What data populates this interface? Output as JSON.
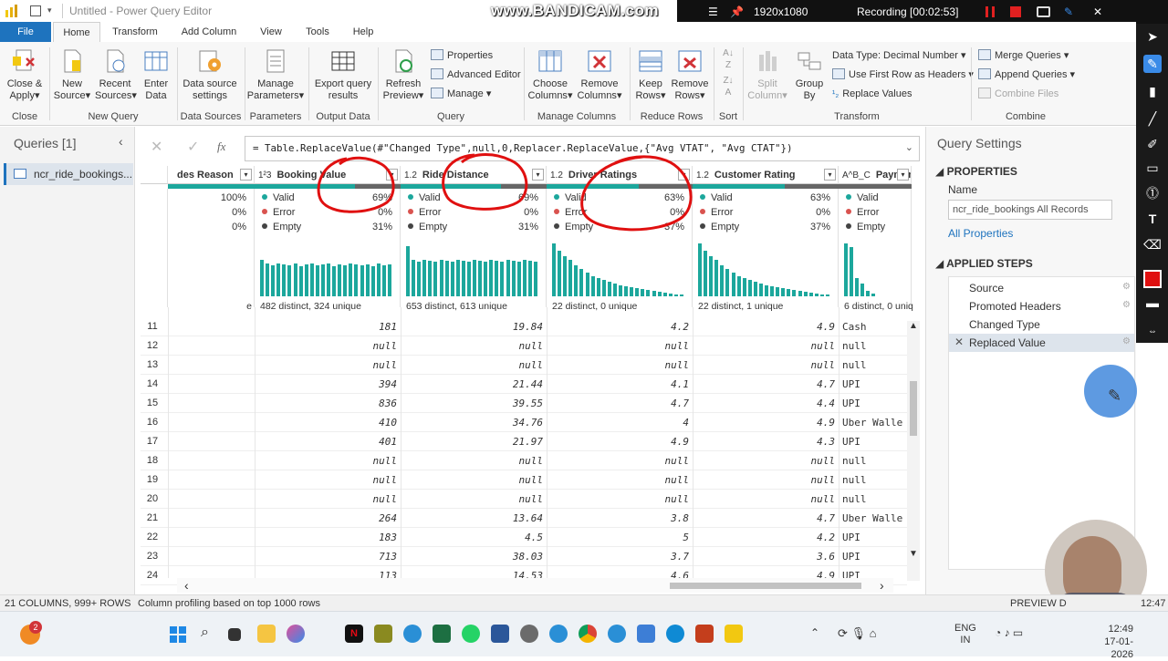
{
  "window": {
    "title": "Untitled - Power Query Editor",
    "watermark": "www.BANDICAM.com",
    "recorder": {
      "resolution": "1920x1080",
      "status": "Recording [00:02:53]"
    }
  },
  "tabs": [
    "File",
    "Home",
    "Transform",
    "Add Column",
    "View",
    "Tools",
    "Help"
  ],
  "ribbon": {
    "close_apply": "Close &\nApply",
    "new_source": "New\nSource",
    "recent_sources": "Recent\nSources",
    "enter_data": "Enter\nData",
    "data_source_settings": "Data source\nsettings",
    "manage_parameters": "Manage\nParameters",
    "export_query_results": "Export query\nresults",
    "refresh_preview": "Refresh\nPreview",
    "properties": "Properties",
    "advanced_editor": "Advanced Editor",
    "manage": "Manage",
    "choose_columns": "Choose\nColumns",
    "remove_columns": "Remove\nColumns",
    "keep_rows": "Keep\nRows",
    "remove_rows": "Remove\nRows",
    "split_column": "Split\nColumn",
    "group_by": "Group\nBy",
    "data_type": "Data Type: Decimal Number",
    "use_first_row": "Use First Row as Headers",
    "replace_values": "Replace Values",
    "merge_queries": "Merge Queries",
    "append_queries": "Append Queries",
    "combine_files": "Combine Files",
    "groups": [
      "Close",
      "New Query",
      "Data Sources",
      "Parameters",
      "Output Data",
      "Query",
      "Manage Columns",
      "Reduce Rows",
      "Sort",
      "Transform",
      "Combine"
    ]
  },
  "queries_pane": {
    "title": "Queries [1]",
    "item": "ncr_ride_bookings..."
  },
  "formula": "= Table.ReplaceValue(#\"Changed Type\",null,0,Replacer.ReplaceValue,{\"Avg VTAT\", \"Avg CTAT\"})",
  "formula_fx": "fx",
  "columns": [
    {
      "type": "",
      "name": "des Reason",
      "valid": "100%",
      "error": "0%",
      "empty": "0%",
      "distinct": ""
    },
    {
      "type": "1²3",
      "name": "Booking Value",
      "valid": "69%",
      "error": "0%",
      "empty": "31%",
      "distinct": "482 distinct, 324 unique"
    },
    {
      "type": "1.2",
      "name": "Ride Distance",
      "valid": "69%",
      "error": "0%",
      "empty": "31%",
      "distinct": "653 distinct, 613 unique"
    },
    {
      "type": "1.2",
      "name": "Driver Ratings",
      "valid": "63%",
      "error": "0%",
      "empty": "37%",
      "distinct": "22 distinct, 0 unique"
    },
    {
      "type": "1.2",
      "name": "Customer Rating",
      "valid": "63%",
      "error": "0%",
      "empty": "37%",
      "distinct": "22 distinct, 1 unique"
    },
    {
      "type": "A^B_C",
      "name": "Payment Met",
      "valid": "",
      "error": "",
      "empty": "",
      "distinct": "6 distinct, 0 uniq"
    }
  ],
  "labels": {
    "valid": "Valid",
    "error": "Error",
    "empty": "Empty"
  },
  "rows": [
    {
      "n": "11",
      "booking": "181",
      "distance": "19.84",
      "driver": "4.2",
      "customer": "4.9",
      "payment": "Cash"
    },
    {
      "n": "12",
      "booking": "null",
      "distance": "null",
      "driver": "null",
      "customer": "null",
      "payment": "null"
    },
    {
      "n": "13",
      "booking": "null",
      "distance": "null",
      "driver": "null",
      "customer": "null",
      "payment": "null"
    },
    {
      "n": "14",
      "booking": "394",
      "distance": "21.44",
      "driver": "4.1",
      "customer": "4.7",
      "payment": "UPI"
    },
    {
      "n": "15",
      "booking": "836",
      "distance": "39.55",
      "driver": "4.7",
      "customer": "4.4",
      "payment": "UPI"
    },
    {
      "n": "16",
      "booking": "410",
      "distance": "34.76",
      "driver": "4",
      "customer": "4.9",
      "payment": "Uber Walle"
    },
    {
      "n": "17",
      "booking": "401",
      "distance": "21.97",
      "driver": "4.9",
      "customer": "4.3",
      "payment": "UPI"
    },
    {
      "n": "18",
      "booking": "null",
      "distance": "null",
      "driver": "null",
      "customer": "null",
      "payment": "null"
    },
    {
      "n": "19",
      "booking": "null",
      "distance": "null",
      "driver": "null",
      "customer": "null",
      "payment": "null"
    },
    {
      "n": "20",
      "booking": "null",
      "distance": "null",
      "driver": "null",
      "customer": "null",
      "payment": "null"
    },
    {
      "n": "21",
      "booking": "264",
      "distance": "13.64",
      "driver": "3.8",
      "customer": "4.7",
      "payment": "Uber Walle"
    },
    {
      "n": "22",
      "booking": "183",
      "distance": "4.5",
      "driver": "5",
      "customer": "4.2",
      "payment": "UPI"
    },
    {
      "n": "23",
      "booking": "713",
      "distance": "38.03",
      "driver": "3.7",
      "customer": "3.6",
      "payment": "UPI"
    },
    {
      "n": "24",
      "booking": "113",
      "distance": "14.53",
      "driver": "4.6",
      "customer": "4.9",
      "payment": "UPI"
    }
  ],
  "settings": {
    "title": "Query Settings",
    "properties": "PROPERTIES",
    "name_label": "Name",
    "name_value": "ncr_ride_bookings All Records",
    "all_properties": "All Properties",
    "applied_steps": "APPLIED STEPS",
    "steps": [
      "Source",
      "Promoted Headers",
      "Changed Type",
      "Replaced Value"
    ]
  },
  "status": {
    "left": "21 COLUMNS, 999+ ROWS",
    "profiling": "Column profiling based on top 1000 rows",
    "right": "PREVIEW D",
    "time": "12:47"
  },
  "taskbar": {
    "badge": "2",
    "lang1": "ENG",
    "lang2": "IN",
    "clock_time": "12:49",
    "clock_date": "17-01-2026"
  },
  "colors": {
    "accent": "#1e73be",
    "teal": "#1ca79c",
    "red_ink": "#e01010"
  }
}
